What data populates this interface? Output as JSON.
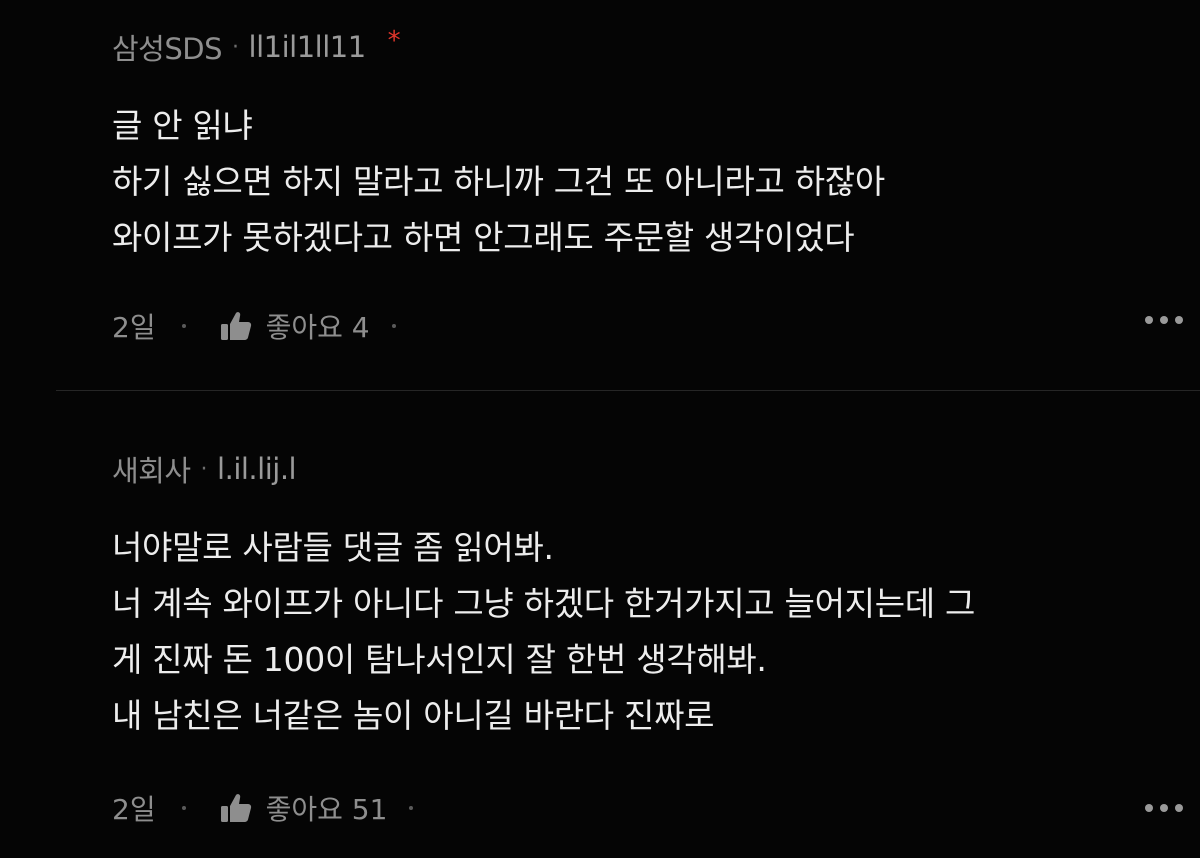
{
  "comments": [
    {
      "company": "삼성SDS",
      "separator": "·",
      "nickname": "ll1il1ll11",
      "badge": "*",
      "lines": [
        "글 안 읽냐",
        "하기 싫으면 하지 말라고 하니까 그건 또 아니라고 하잖아",
        "와이프가 못하겠다고 하면 안그래도 주문할 생각이었다"
      ],
      "time": "2일",
      "like_label": "좋아요 4"
    },
    {
      "company": "새회사",
      "separator": "·",
      "nickname": "l.il.lij.l",
      "lines": [
        "너야말로 사람들 댓글 좀 읽어봐.",
        "너 계속 와이프가 아니다 그냥 하겠다 한거가지고 늘어지는데 그",
        "게 진짜 돈 100이 탐나서인지 잘 한번 생각해봐.",
        "내 남친은 너같은 놈이 아니길 바란다 진짜로"
      ],
      "time": "2일",
      "like_label": "좋아요 51"
    }
  ],
  "icons": {
    "like": "thumbs-up-icon",
    "more": "more-horizontal-icon"
  },
  "colors": {
    "background": "#050505",
    "text": "#ededed",
    "muted": "#8e8e8e",
    "badge": "#e0352b"
  }
}
